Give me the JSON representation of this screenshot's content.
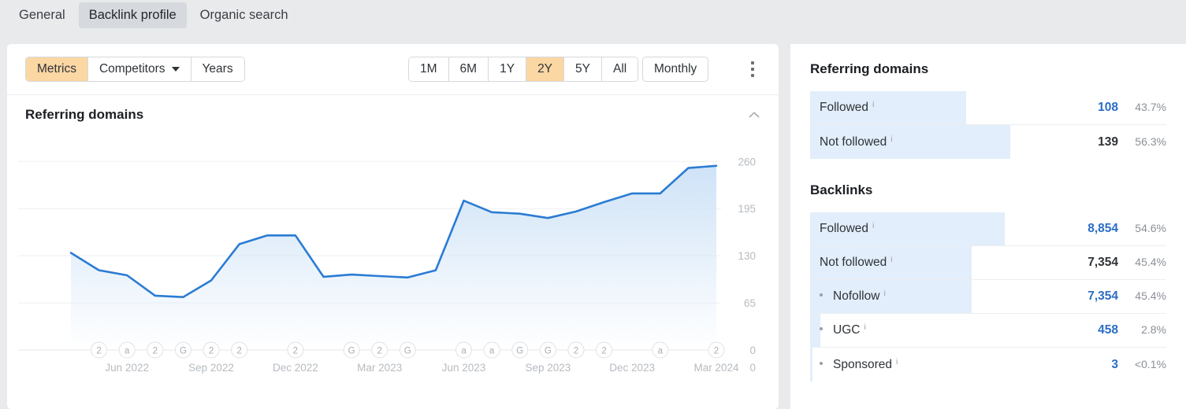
{
  "tabs": [
    {
      "label": "General",
      "active": false
    },
    {
      "label": "Backlink profile",
      "active": true
    },
    {
      "label": "Organic search",
      "active": false
    }
  ],
  "toolbar": {
    "metrics_label": "Metrics",
    "competitors_label": "Competitors",
    "years_label": "Years",
    "ranges": [
      "1M",
      "6M",
      "1Y",
      "2Y",
      "5Y",
      "All"
    ],
    "range_selected": "2Y",
    "frequency_label": "Monthly",
    "more_menu_icon": "kebab-menu-icon"
  },
  "chart_card": {
    "title": "Referring domains",
    "collapse_icon": "chevron-up-icon"
  },
  "chart_data": {
    "type": "area",
    "title": "Referring domains",
    "xlabel": "",
    "ylabel": "",
    "ylim": [
      0,
      282
    ],
    "yticks": [
      0,
      65,
      130,
      195,
      260
    ],
    "grid": true,
    "legend": "none",
    "line_color": "#2b7cd3",
    "fill_color": "#cfe3f7",
    "x_tick_labels": [
      "Jun 2022",
      "Sep 2022",
      "Dec 2022",
      "Mar 2023",
      "Jun 2023",
      "Sep 2023",
      "Dec 2023",
      "Mar 2024"
    ],
    "x": [
      "Apr 2022",
      "May 2022",
      "Jun 2022",
      "Jul 2022",
      "Aug 2022",
      "Sep 2022",
      "Oct 2022",
      "Nov 2022",
      "Dec 2022",
      "Jan 2023",
      "Feb 2023",
      "Mar 2023",
      "Apr 2023",
      "May 2023",
      "Jun 2023",
      "Jul 2023",
      "Aug 2023",
      "Sep 2023",
      "Oct 2023",
      "Nov 2023",
      "Dec 2023",
      "Jan 2024",
      "Feb 2024",
      "Mar 2024"
    ],
    "values": [
      134,
      110,
      103,
      75,
      73,
      96,
      146,
      158,
      158,
      101,
      104,
      102,
      100,
      110,
      206,
      190,
      188,
      182,
      191,
      204,
      216,
      216,
      251,
      254
    ],
    "event_markers": [
      {
        "x_index": 1,
        "glyph": "2"
      },
      {
        "x_index": 2,
        "glyph": "a"
      },
      {
        "x_index": 3,
        "glyph": "2"
      },
      {
        "x_index": 4,
        "glyph": "G"
      },
      {
        "x_index": 5,
        "glyph": "2"
      },
      {
        "x_index": 6,
        "glyph": "2"
      },
      {
        "x_index": 8,
        "glyph": "2"
      },
      {
        "x_index": 10,
        "glyph": "G"
      },
      {
        "x_index": 11,
        "glyph": "2"
      },
      {
        "x_index": 12,
        "glyph": "G"
      },
      {
        "x_index": 14,
        "glyph": "a"
      },
      {
        "x_index": 15,
        "glyph": "a"
      },
      {
        "x_index": 16,
        "glyph": "G"
      },
      {
        "x_index": 17,
        "glyph": "G"
      },
      {
        "x_index": 18,
        "glyph": "2"
      },
      {
        "x_index": 19,
        "glyph": "2"
      },
      {
        "x_index": 21,
        "glyph": "a"
      },
      {
        "x_index": 23,
        "glyph": "2"
      }
    ]
  },
  "side": {
    "referring_domains": {
      "title": "Referring domains",
      "rows": [
        {
          "label": "Followed",
          "info": "i",
          "value": "108",
          "pct": "43.7%",
          "bar_pct": 43.7,
          "link": true,
          "sub": false
        },
        {
          "label": "Not followed",
          "info": "i",
          "value": "139",
          "pct": "56.3%",
          "bar_pct": 56.3,
          "link": false,
          "sub": false
        }
      ]
    },
    "backlinks": {
      "title": "Backlinks",
      "rows": [
        {
          "label": "Followed",
          "info": "i",
          "value": "8,854",
          "pct": "54.6%",
          "bar_pct": 54.6,
          "link": true,
          "sub": false
        },
        {
          "label": "Not followed",
          "info": "i",
          "value": "7,354",
          "pct": "45.4%",
          "bar_pct": 45.4,
          "link": false,
          "sub": false
        },
        {
          "label": "Nofollow",
          "info": "i",
          "value": "7,354",
          "pct": "45.4%",
          "bar_pct": 45.4,
          "link": true,
          "sub": true
        },
        {
          "label": "UGC",
          "info": "i",
          "value": "458",
          "pct": "2.8%",
          "bar_pct": 2.8,
          "link": true,
          "sub": true
        },
        {
          "label": "Sponsored",
          "info": "i",
          "value": "3",
          "pct": "<0.1%",
          "bar_pct": 0.6,
          "link": true,
          "sub": true
        }
      ]
    }
  }
}
